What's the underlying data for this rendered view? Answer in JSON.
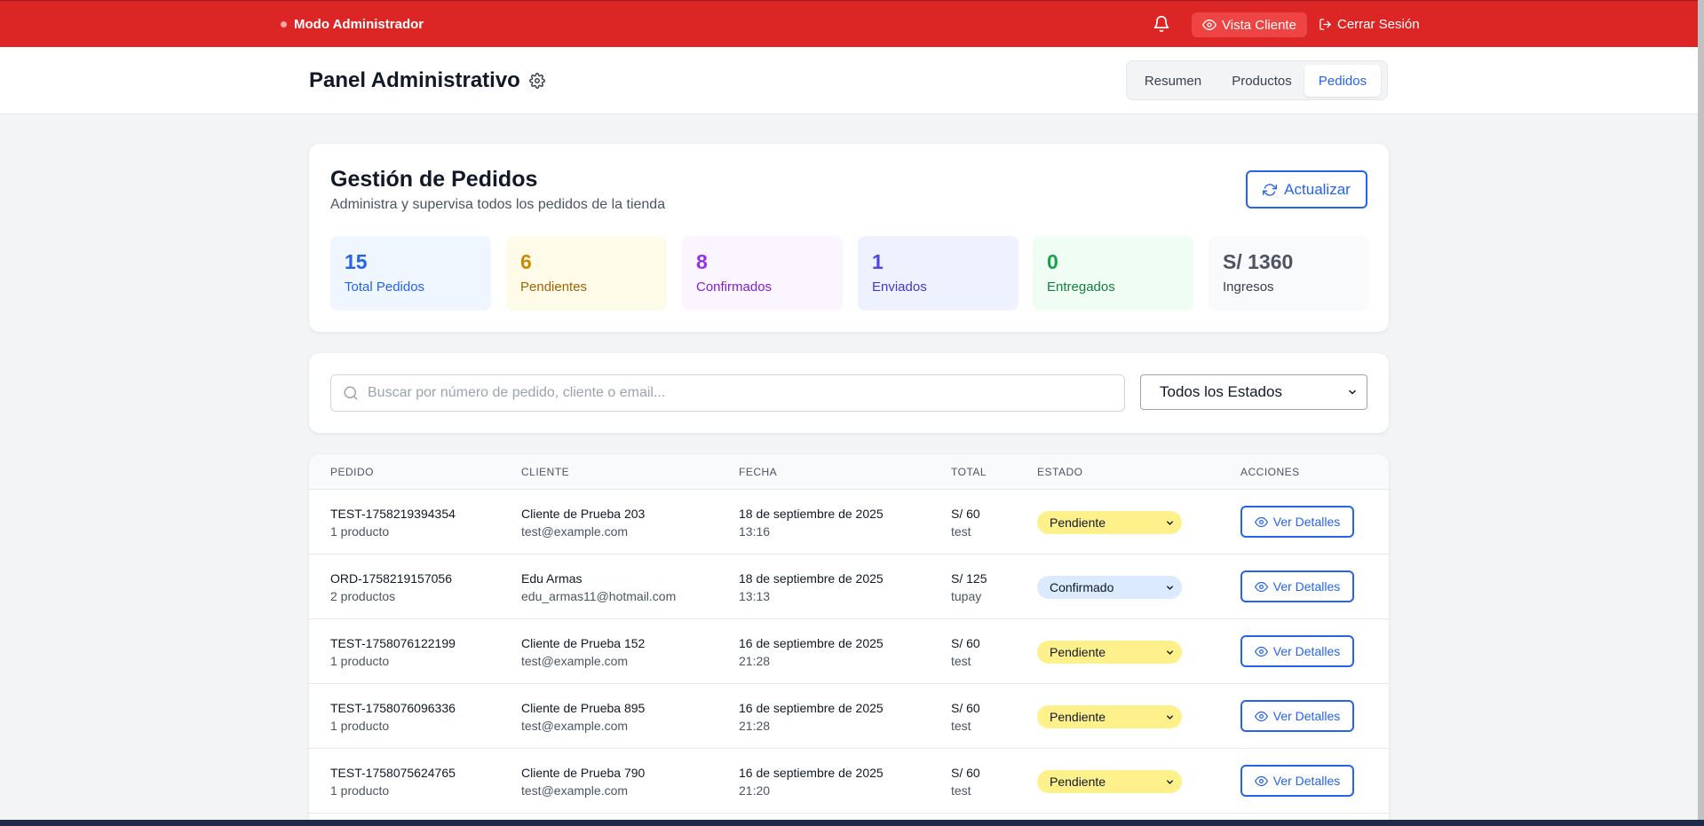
{
  "topbar": {
    "mode_label": "Modo Administrador",
    "vista_label": "Vista Cliente",
    "logout_label": "Cerrar Sesión",
    "icons": [
      "bell-icon",
      "eye-icon",
      "logout-icon"
    ]
  },
  "header": {
    "title": "Panel Administrativo",
    "tabs": [
      {
        "label": "Resumen"
      },
      {
        "label": "Productos"
      },
      {
        "label": "Pedidos",
        "active": true
      }
    ]
  },
  "summary": {
    "title": "Gestión de Pedidos",
    "subtitle": "Administra y supervisa todos los pedidos de la tienda",
    "refresh_label": "Actualizar",
    "stats": [
      {
        "value": "15",
        "label": "Total Pedidos",
        "bg": "#eff6ff",
        "num_color": "#2563eb",
        "lbl_color": "#2563eb"
      },
      {
        "value": "6",
        "label": "Pendientes",
        "bg": "#fefce8",
        "num_color": "#ca8a04",
        "lbl_color": "#a16207"
      },
      {
        "value": "8",
        "label": "Confirmados",
        "bg": "#faf5ff",
        "num_color": "#9333ea",
        "lbl_color": "#7e22ce"
      },
      {
        "value": "1",
        "label": "Enviados",
        "bg": "#eef2ff",
        "num_color": "#4f46e5",
        "lbl_color": "#4338ca"
      },
      {
        "value": "0",
        "label": "Entregados",
        "bg": "#f0fdf4",
        "num_color": "#16a34a",
        "lbl_color": "#15803d"
      },
      {
        "value": "S/ 1360",
        "label": "Ingresos",
        "bg": "#f9fafb",
        "num_color": "#4b5563",
        "lbl_color": "#374151"
      }
    ]
  },
  "filters": {
    "search_placeholder": "Buscar por número de pedido, cliente o email...",
    "status_selected": "Todos los Estados"
  },
  "table": {
    "headers": [
      "PEDIDO",
      "CLIENTE",
      "FECHA",
      "TOTAL",
      "ESTADO",
      "ACCIONES"
    ],
    "action_label": "Ver Detalles",
    "rows": [
      {
        "order": "TEST-1758219394354",
        "items": "1 producto",
        "client": "Cliente de Prueba 203",
        "email": "test@example.com",
        "date": "18 de septiembre de 2025",
        "time": "13:16",
        "total": "S/ 60",
        "method": "test",
        "status": "Pendiente",
        "status_type": "pend"
      },
      {
        "order": "ORD-1758219157056",
        "items": "2 productos",
        "client": "Edu Armas",
        "email": "edu_armas11@hotmail.com",
        "date": "18 de septiembre de 2025",
        "time": "13:13",
        "total": "S/ 125",
        "method": "tupay",
        "status": "Confirmado",
        "status_type": "conf"
      },
      {
        "order": "TEST-1758076122199",
        "items": "1 producto",
        "client": "Cliente de Prueba 152",
        "email": "test@example.com",
        "date": "16 de septiembre de 2025",
        "time": "21:28",
        "total": "S/ 60",
        "method": "test",
        "status": "Pendiente",
        "status_type": "pend"
      },
      {
        "order": "TEST-1758076096336",
        "items": "1 producto",
        "client": "Cliente de Prueba 895",
        "email": "test@example.com",
        "date": "16 de septiembre de 2025",
        "time": "21:28",
        "total": "S/ 60",
        "method": "test",
        "status": "Pendiente",
        "status_type": "pend"
      },
      {
        "order": "TEST-1758075624765",
        "items": "1 producto",
        "client": "Cliente de Prueba 790",
        "email": "test@example.com",
        "date": "16 de septiembre de 2025",
        "time": "21:20",
        "total": "S/ 60",
        "method": "test",
        "status": "Pendiente",
        "status_type": "pend"
      }
    ]
  }
}
